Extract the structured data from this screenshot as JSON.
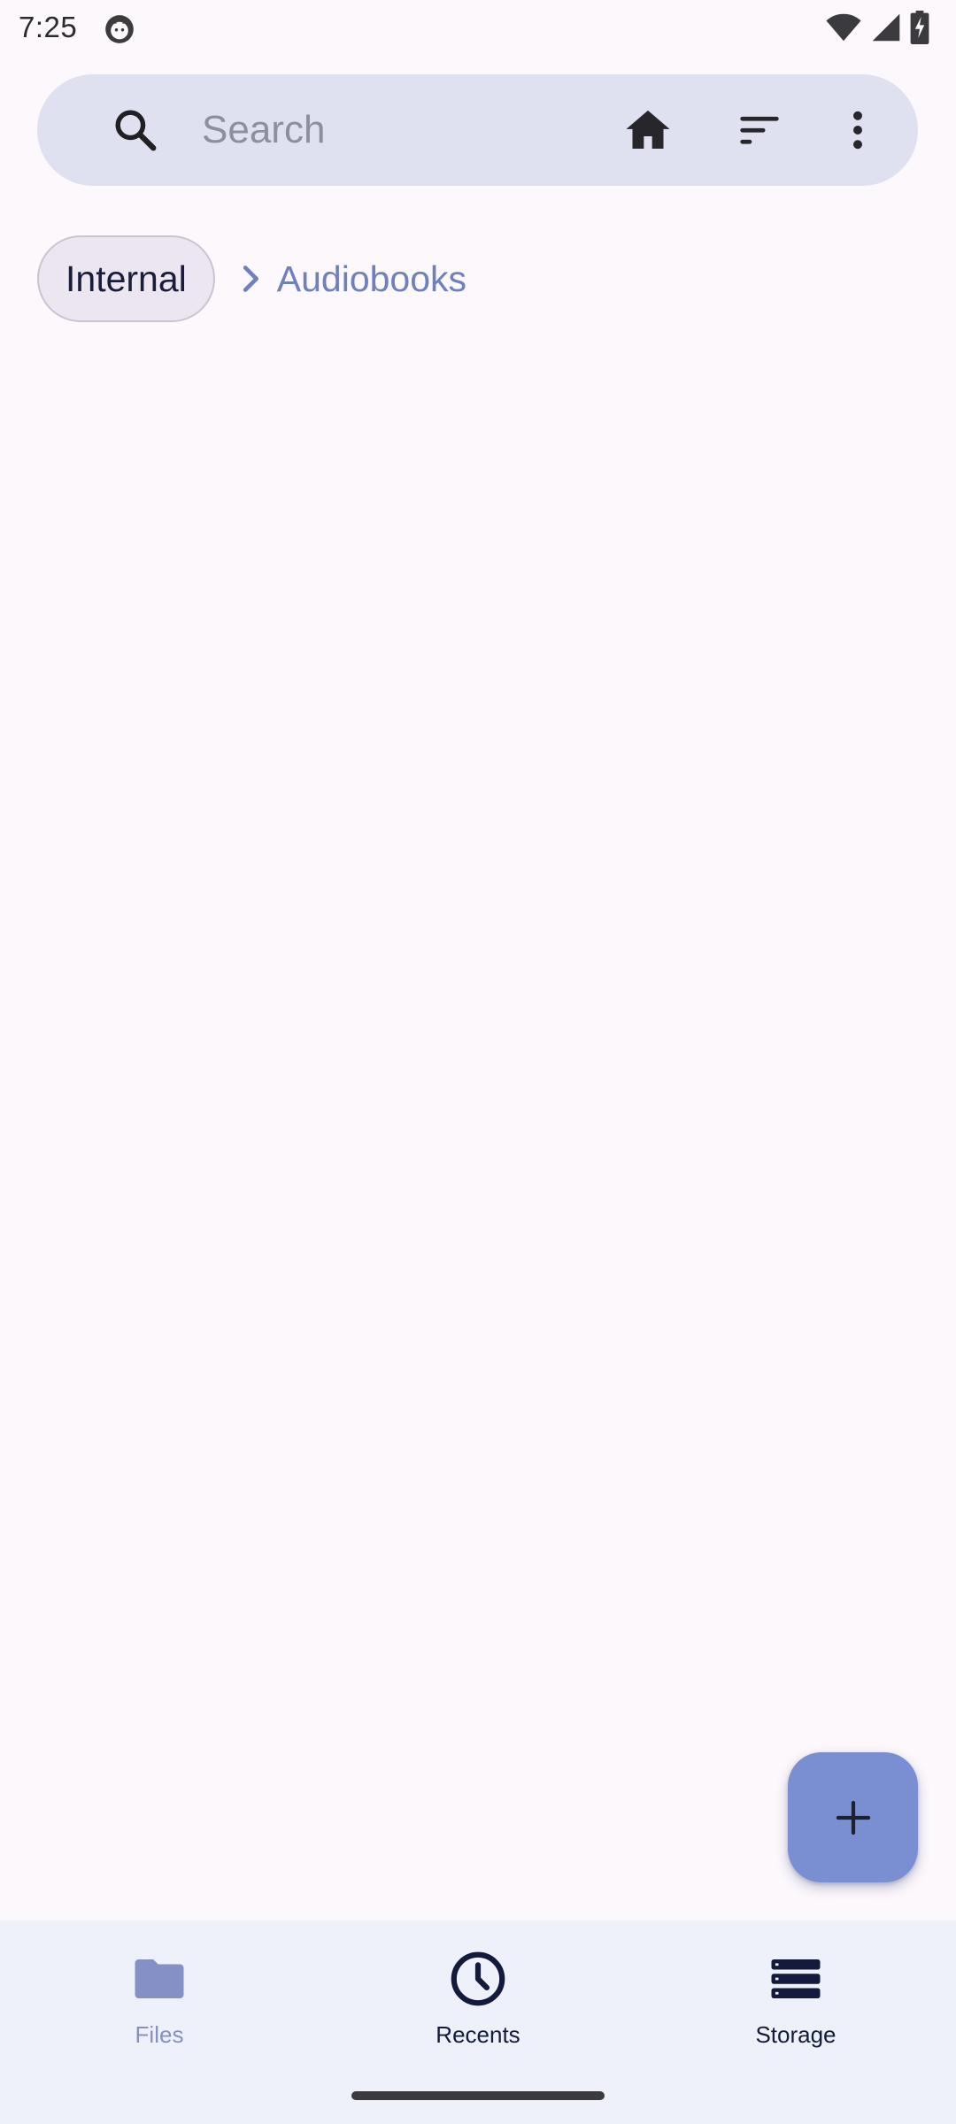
{
  "status_bar": {
    "time": "7:25",
    "icons": [
      "notification-cat-icon",
      "wifi-icon",
      "signal-icon",
      "battery-charging-icon"
    ]
  },
  "search": {
    "placeholder": "Search",
    "value": "",
    "icons": [
      "search-icon",
      "home-icon",
      "sort-icon",
      "more-vert-icon"
    ]
  },
  "breadcrumb": {
    "root": "Internal",
    "current": "Audiobooks"
  },
  "fab": {
    "icon": "add-icon"
  },
  "bottom_nav": {
    "items": [
      {
        "label": "Files",
        "icon": "folder-icon"
      },
      {
        "label": "Recents",
        "icon": "clock-icon"
      },
      {
        "label": "Storage",
        "icon": "storage-icon"
      }
    ]
  },
  "colors": {
    "background": "#fcf8fc",
    "search_bar": "#dfe1f0",
    "accent": "#7a8ed2",
    "nav_background": "#eef0fa",
    "breadcrumb_current": "#6e80be"
  }
}
